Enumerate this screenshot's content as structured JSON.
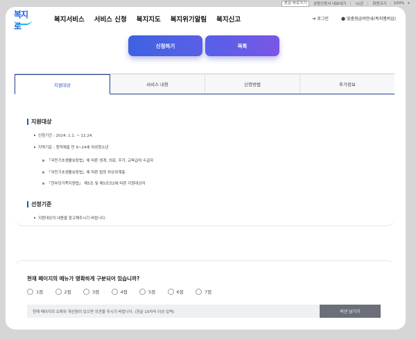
{
  "util_bar": {
    "view_toggle": "본문 바로가기",
    "certificate": "공동인증서 내보내기",
    "city": "시/군",
    "screen": "화면크기",
    "minus": "-",
    "zoom": "100%",
    "plus": "+"
  },
  "header": {
    "logo": "복지로",
    "nav": [
      "복지서비스",
      "서비스 신청",
      "복지지도",
      "복지위기알림",
      "복지신고"
    ],
    "login": "로그인",
    "login_icon": "login-icon",
    "guide": "맞춤형급여안내(복지멤버십)",
    "guide_icon": "person-icon"
  },
  "actions": {
    "apply": "신청하기",
    "list": "목록"
  },
  "tabs": [
    "지원대상",
    "서비스 내용",
    "신청방법",
    "추가정보"
  ],
  "content": {
    "support_title": "지원대상",
    "support_items": [
      "신청기간 : 2024. 1.1. ~ 12.24.",
      "지역기준 : 청약제출 만 9~24세 여성청소년"
    ],
    "support_subitems": [
      "「국민기초생활보장법」에 따른 생계, 의료, 주거, 교육급여 수급자",
      "「국민기초생활보장법」에 따른 법정 차상위계층",
      "「한부모가족지원법」 제5조 및 제5조의2에 따른 지원대상자"
    ],
    "selection_title": "선정기준",
    "selection_items": [
      "지원대상의 내용을 참고해주시기 바랍니다."
    ]
  },
  "survey": {
    "question": "현재 페이지의 메뉴가 명확하게 구분되어 있습니까?",
    "ratings": [
      "1점",
      "2점",
      "3점",
      "4점",
      "5점",
      "6점",
      "7점"
    ],
    "input_placeholder": "현재 페이지의 오류와 개선점이 있으면 의견을 주시기 바랍니다. (한글 10자리 이상 입력)",
    "submit": "의견 남기기"
  }
}
